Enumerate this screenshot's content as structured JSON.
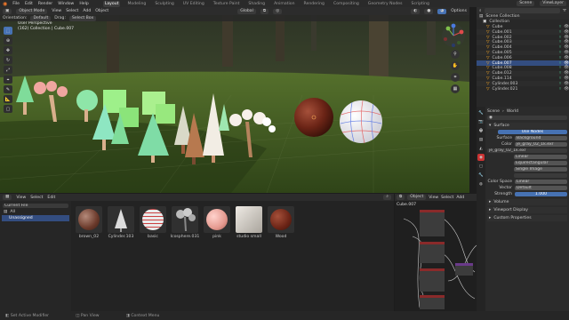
{
  "topbar": {
    "menus": [
      "File",
      "Edit",
      "Render",
      "Window",
      "Help"
    ],
    "workspaces": [
      "Layout",
      "Modeling",
      "Sculpting",
      "UV Editing",
      "Texture Paint",
      "Shading",
      "Animation",
      "Rendering",
      "Compositing",
      "Geometry Nodes",
      "Scripting"
    ],
    "active_workspace": "Layout",
    "scene": "Scene",
    "view_layer": "ViewLayer"
  },
  "viewport_header": {
    "mode": "Object Mode",
    "menus": [
      "View",
      "Select",
      "Add",
      "Object"
    ],
    "orientation_label": "Orientation:",
    "orientation_value": "Default",
    "drag_label": "Drag:",
    "drag_value": "Select Box",
    "transform": "Global",
    "options": "Options"
  },
  "viewport": {
    "view_name": "User Perspective",
    "context": "(162) Collection | Cube.007"
  },
  "outliner": {
    "root": "Scene Collection",
    "collection": "Collection",
    "items": [
      "Cube",
      "Cube.001",
      "Cube.002",
      "Cube.003",
      "Cube.004",
      "Cube.005",
      "Cube.006",
      "Cube.007",
      "Cube.008",
      "Cube.012",
      "Cube.114",
      "Cylinder.003",
      "Cylinder.021"
    ],
    "selected": "Cube.007"
  },
  "properties": {
    "scene_label": "Scene",
    "world_label": "World",
    "surface_panel": "Surface",
    "use_nodes": "Use Nodes",
    "surface_label": "Surface",
    "surface_value": "Background",
    "color_label": "Color",
    "color_value": "je_gray_02_1k.exr",
    "image_value": "je_gray_02_1k.exr",
    "interp": "Linear",
    "projection": "Equirectangular",
    "source": "Single Image",
    "color_space_label": "Color Space",
    "color_space_value": "Linear",
    "vector_label": "Vector",
    "vector_value": "Default",
    "strength_label": "Strength",
    "strength_value": "1.000",
    "panels": [
      "Volume",
      "Viewport Display",
      "Custom Properties"
    ]
  },
  "asset_browser": {
    "menus": [
      "View",
      "Select",
      "Edit"
    ],
    "library_label": "Current File",
    "categories": [
      "All",
      "Unassigned"
    ],
    "assets": [
      "brown_02",
      "Cylinder.103",
      "basic",
      "Icosphere.031",
      "pink",
      "studio small",
      "Wood"
    ]
  },
  "node_editor": {
    "object_label": "Object",
    "menus": [
      "View",
      "Select",
      "Add"
    ],
    "node_name": "Cube.007"
  },
  "statusbar": {
    "items": [
      "Set Active Modifier",
      "Pan View",
      "Context Menu"
    ]
  },
  "colors": {
    "accent": "#4772b3",
    "grass": "#3f5a23",
    "mint": "#7fdc9a",
    "pink_tree": "#f0a6a0",
    "wood_ball": "#6b2416"
  }
}
